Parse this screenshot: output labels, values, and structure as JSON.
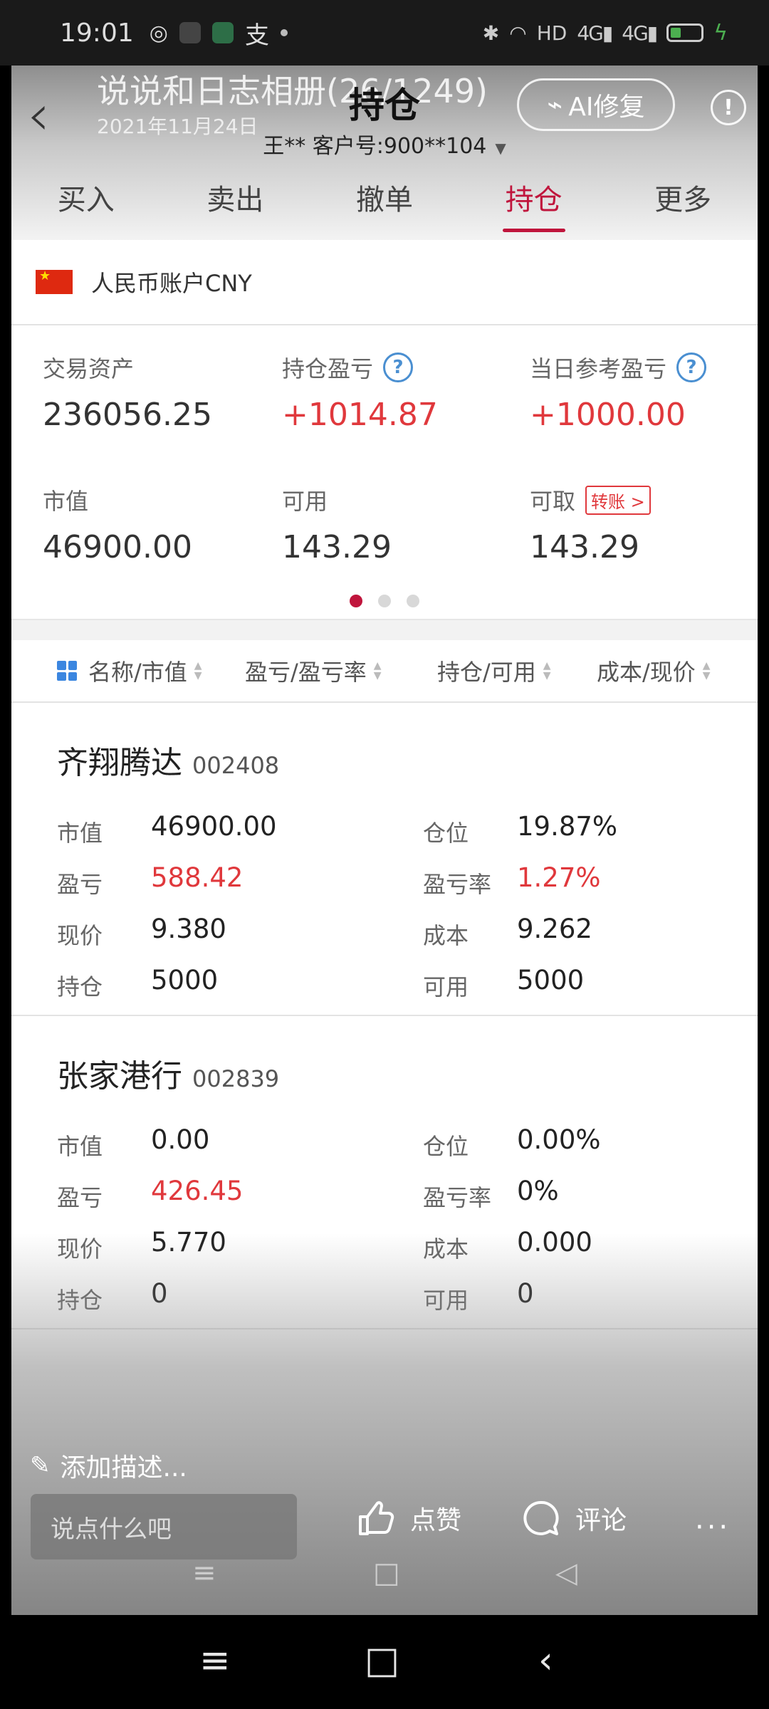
{
  "status_bar": {
    "time": "19:01",
    "alipay_glyph": "支",
    "network": "HD",
    "signal1": "4G",
    "signal2": "4G"
  },
  "header": {
    "album_title": "说说和日志相册(26/1249)",
    "album_date": "2021年11月24日",
    "page_title": "持仓",
    "customer": "王**  客户号:900**104",
    "ai_label": "AI修复",
    "info_label": "!"
  },
  "tabs": [
    {
      "label": "买入"
    },
    {
      "label": "卖出"
    },
    {
      "label": "撤单"
    },
    {
      "label": "持仓"
    },
    {
      "label": "更多"
    }
  ],
  "account": {
    "label": "人民币账户CNY"
  },
  "assets": {
    "trade_assets": {
      "label": "交易资产",
      "value": "236056.25"
    },
    "position_pl": {
      "label": "持仓盈亏",
      "value": "+1014.87"
    },
    "daily_pl": {
      "label": "当日参考盈亏",
      "value": "+1000.00"
    },
    "market_value": {
      "label": "市值",
      "value": "46900.00"
    },
    "available": {
      "label": "可用",
      "value": "143.29"
    },
    "withdrawable": {
      "label": "可取",
      "value": "143.29",
      "transfer": "转账 >"
    }
  },
  "sort_header": {
    "col1": "名称/市值",
    "col2": "盈亏/盈亏率",
    "col3": "持仓/可用",
    "col4": "成本/现价"
  },
  "holdings": [
    {
      "name": "齐翔腾达",
      "code": "002408",
      "labels": {
        "mv": "市值",
        "pos": "仓位",
        "pl": "盈亏",
        "plr": "盈亏率",
        "price": "现价",
        "cost": "成本",
        "hold": "持仓",
        "avail": "可用"
      },
      "mv": "46900.00",
      "pos": "19.87%",
      "pl": "588.42",
      "plr": "1.27%",
      "price": "9.380",
      "cost": "9.262",
      "hold": "5000",
      "avail": "5000"
    },
    {
      "name": "张家港行",
      "code": "002839",
      "labels": {
        "mv": "市值",
        "pos": "仓位",
        "pl": "盈亏",
        "plr": "盈亏率",
        "price": "现价",
        "cost": "成本",
        "hold": "持仓",
        "avail": "可用"
      },
      "mv": "0.00",
      "pos": "0.00%",
      "pl": "426.45",
      "plr": "0%",
      "price": "5.770",
      "cost": "0.000",
      "hold": "0",
      "avail": "0"
    }
  ],
  "overlay": {
    "add_desc": "添加描述...",
    "comment_placeholder": "说点什么吧",
    "like": "点赞",
    "comment": "评论",
    "more": "···"
  },
  "colors": {
    "accent": "#c0153c",
    "gain": "#e0383c",
    "help_blue": "#4a8fd1"
  }
}
